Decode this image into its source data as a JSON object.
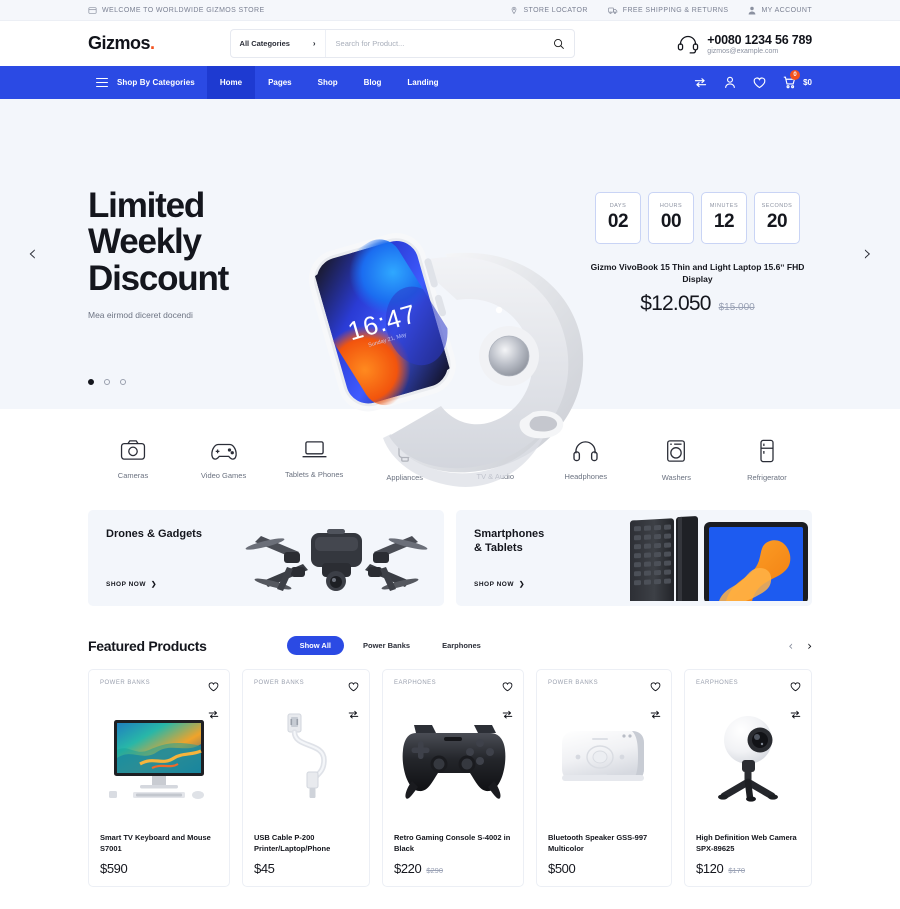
{
  "topbar": {
    "welcome": "WELCOME TO WORLDWIDE GIZMOS STORE",
    "welcome_icon": "card-icon",
    "links": [
      {
        "label": "STORE LOCATOR",
        "icon": "map-pin-icon"
      },
      {
        "label": "FREE SHIPPING & RETURNS",
        "icon": "truck-icon"
      },
      {
        "label": "MY ACCOUNT",
        "icon": "user-icon"
      }
    ]
  },
  "header": {
    "logo": "Gizmos",
    "logo_dot": ".",
    "category_selected": "All Categories",
    "search_placeholder": "Search for Product...",
    "search_value": "",
    "search_icon": "search-icon",
    "support_icon": "headset-icon",
    "phone": "+0080 1234 56 789",
    "email": "gizmos@example.com"
  },
  "nav": {
    "categories_label": "Shop By Categories",
    "links": [
      {
        "label": "Home",
        "active": true
      },
      {
        "label": "Pages",
        "active": false
      },
      {
        "label": "Shop",
        "active": false
      },
      {
        "label": "Blog",
        "active": false
      },
      {
        "label": "Landing",
        "active": false
      }
    ],
    "icons": [
      "compare-icon",
      "account-icon",
      "wishlist-heart-icon",
      "cart-icon"
    ],
    "cart_count": "0",
    "cart_total": "$0",
    "accent_color": "#2b4ae4",
    "badge_color": "#f4511e"
  },
  "hero": {
    "title_lines": [
      "Limited",
      "Weekly",
      "Discount"
    ],
    "title": "Limited Weekly Discount",
    "subtitle": "Mea eirmod diceret docendi",
    "watch_time": "16:47",
    "countdown": [
      {
        "label": "DAYS",
        "value": "02"
      },
      {
        "label": "HOURS",
        "value": "00"
      },
      {
        "label": "MINUTES",
        "value": "12"
      },
      {
        "label": "SECONDS",
        "value": "20"
      }
    ],
    "offer_name": "Gizmo VivoBook 15 Thin and Light Laptop 15.6ˮ FHD Display",
    "price": "$12.050",
    "old_price": "$15.000",
    "prev_arrow": "‹",
    "next_arrow": "›",
    "slides": 3,
    "active_slide": 0,
    "bg_color": "#f3f6fb"
  },
  "categories": [
    {
      "label": "Cameras",
      "icon": "camera-icon"
    },
    {
      "label": "Video Games",
      "icon": "gamepad-icon"
    },
    {
      "label": "Tablets & Phones",
      "icon": "laptop-icon"
    },
    {
      "label": "Appliances",
      "icon": "smartwatch-icon"
    },
    {
      "label": "TV & Audio",
      "icon": "monitor-icon"
    },
    {
      "label": "Headphones",
      "icon": "headphones-icon"
    },
    {
      "label": "Washers",
      "icon": "washing-machine-icon"
    },
    {
      "label": "Refrigerator",
      "icon": "fridge-icon"
    }
  ],
  "promos": [
    {
      "title": "Drones & Gadgets",
      "title_line1": "Drones & Gadgets",
      "title_line2": "",
      "cta": "SHOP NOW",
      "arrow": "❯",
      "image": "drone-image"
    },
    {
      "title": "Smartphones & Tablets",
      "title_line1": "Smartphones",
      "title_line2": "& Tablets",
      "cta": "SHOP NOW",
      "arrow": "❯",
      "image": "tablet-keyboard-image"
    }
  ],
  "featured": {
    "title": "Featured Products",
    "tabs": [
      {
        "label": "Show All",
        "active": true
      },
      {
        "label": "Power Banks",
        "active": false
      },
      {
        "label": "Earphones",
        "active": false
      }
    ],
    "prev_arrow": "‹",
    "next_arrow": "›",
    "products": [
      {
        "category": "POWER BANKS",
        "name": "Smart TV Keyboard and Mouse S7001",
        "price": "$590",
        "old_price": "",
        "image": "monitor-keyboard-mouse-image",
        "wishlist_icon": "heart-icon",
        "compare_icon": "compare-icon"
      },
      {
        "category": "POWER BANKS",
        "name": "USB Cable P-200 Printer/Laptop/Phone",
        "price": "$45",
        "old_price": "",
        "image": "usb-cable-image",
        "wishlist_icon": "heart-icon",
        "compare_icon": "compare-icon"
      },
      {
        "category": "EARPHONES",
        "name": "Retro Gaming Console S-4002 in Black",
        "price": "$220",
        "old_price": "$290",
        "image": "gamepad-image",
        "wishlist_icon": "heart-icon",
        "compare_icon": "compare-icon"
      },
      {
        "category": "POWER BANKS",
        "name": "Bluetooth Speaker GSS-997 Multicolor",
        "price": "$500",
        "old_price": "",
        "image": "bluetooth-speaker-image",
        "wishlist_icon": "heart-icon",
        "compare_icon": "compare-icon"
      },
      {
        "category": "EARPHONES",
        "name": "High Definition Web Camera SPX-89625",
        "price": "$120",
        "old_price": "$170",
        "image": "web-camera-image",
        "wishlist_icon": "heart-icon",
        "compare_icon": "compare-icon"
      }
    ]
  }
}
